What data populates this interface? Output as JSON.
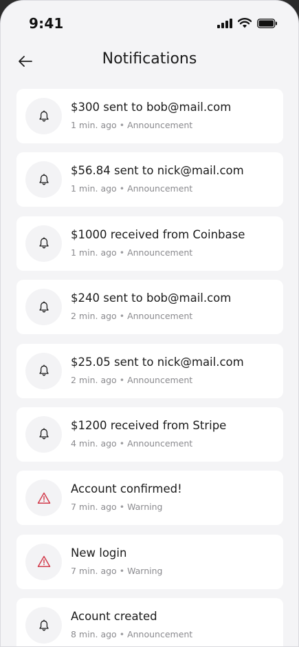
{
  "status_bar": {
    "time": "9:41"
  },
  "header": {
    "title": "Notifications"
  },
  "colors": {
    "background": "#f4f4f6",
    "card": "#ffffff",
    "warning": "#d23a4a",
    "text": "#1a1a1a",
    "meta": "#8a8a8e"
  },
  "notifications": [
    {
      "title": "$300 sent to bob@mail.com",
      "time": "1 min. ago",
      "type": "Announcement",
      "icon": "bell-icon"
    },
    {
      "title": "$56.84 sent to nick@mail.com",
      "time": "1 min. ago",
      "type": "Announcement",
      "icon": "bell-icon"
    },
    {
      "title": "$1000 received from Coinbase",
      "time": "1 min. ago",
      "type": "Announcement",
      "icon": "bell-icon"
    },
    {
      "title": "$240 sent to bob@mail.com",
      "time": "2 min. ago",
      "type": "Announcement",
      "icon": "bell-icon"
    },
    {
      "title": "$25.05 sent to nick@mail.com",
      "time": "2 min. ago",
      "type": "Announcement",
      "icon": "bell-icon"
    },
    {
      "title": "$1200 received from Stripe",
      "time": "4 min. ago",
      "type": "Announcement",
      "icon": "bell-icon"
    },
    {
      "title": "Account confirmed!",
      "time": "7 min. ago",
      "type": "Warning",
      "icon": "warning-icon"
    },
    {
      "title": "New login",
      "time": "7 min. ago",
      "type": "Warning",
      "icon": "warning-icon"
    },
    {
      "title": "Acount created",
      "time": "8 min. ago",
      "type": "Announcement",
      "icon": "bell-icon"
    }
  ]
}
